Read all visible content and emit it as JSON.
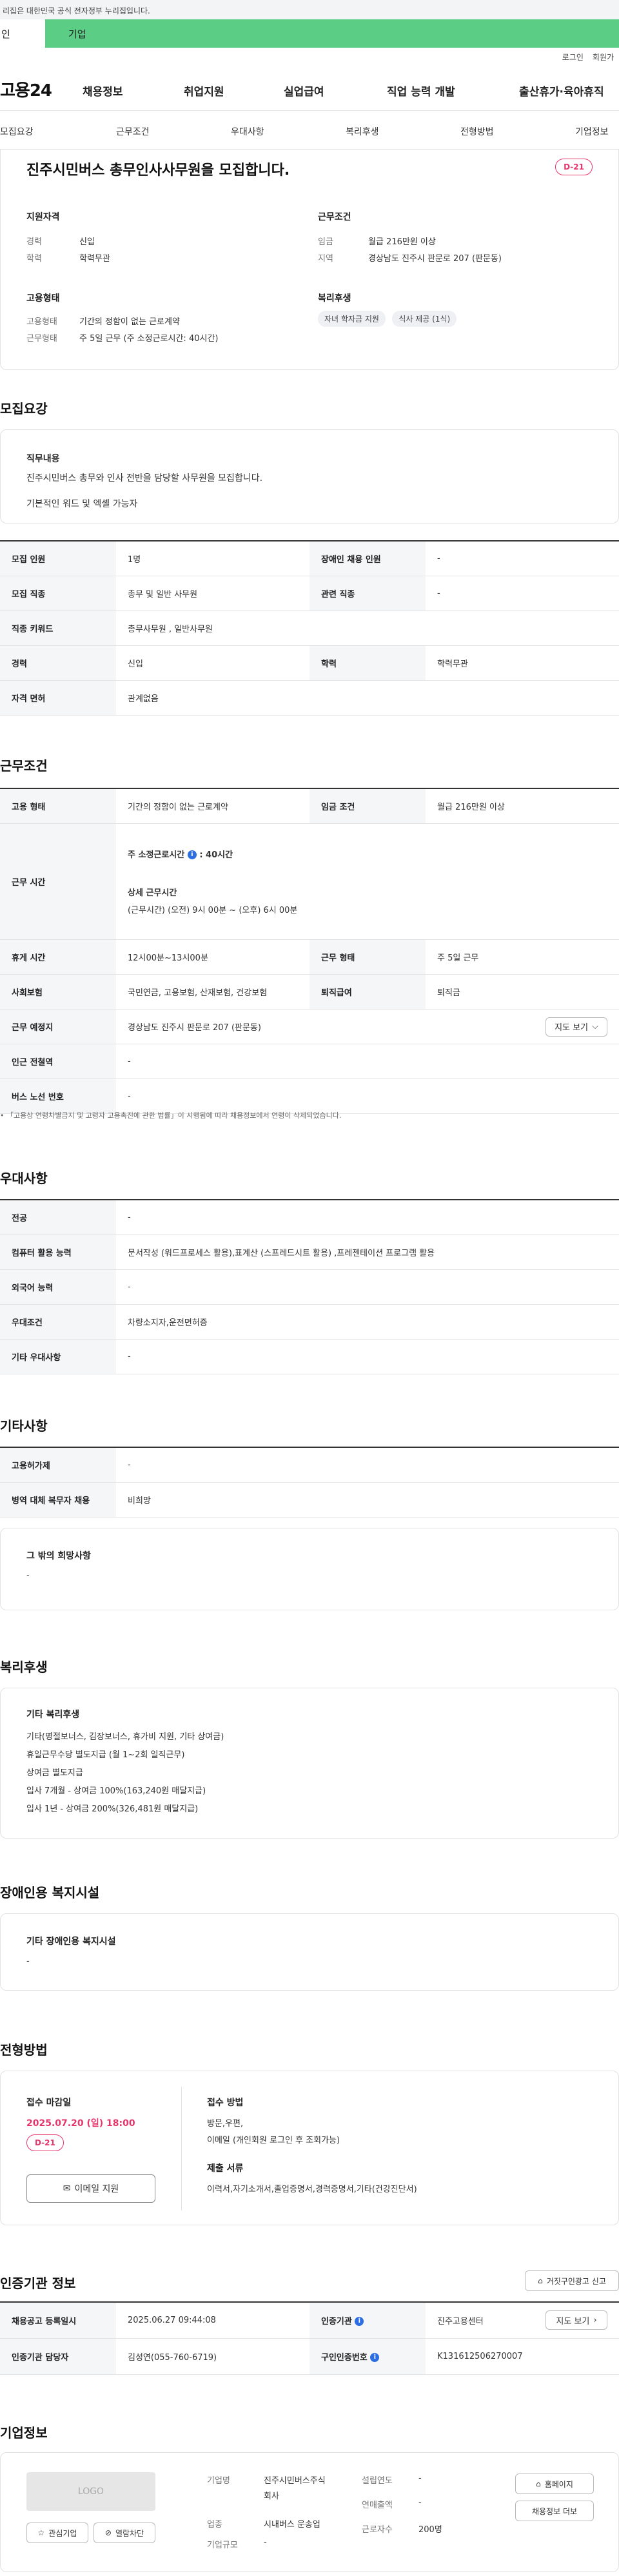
{
  "gov_bar": "이 누리집은 대한민국 공식 전자정부 누리집입니다.",
  "gov_bar_visible": "리집은 대한민국 공식 전자정부 누리집입니다.",
  "tabs": {
    "personal": "인",
    "company": "기업"
  },
  "util": {
    "login": "로그인",
    "join": "회원가"
  },
  "logo": "고용24",
  "gnb": [
    "채용정보",
    "취업지원",
    "실업급여",
    "직업 능력 개발",
    "출산휴가·육아휴직"
  ],
  "subtabs": [
    "모집요강",
    "근무조건",
    "우대사항",
    "복리후생",
    "전형방법",
    "기업정보"
  ],
  "summary": {
    "title": "진주시민버스 총무인사사무원을 모집합니다.",
    "dday": "D-21",
    "qual": {
      "heading": "지원자격",
      "rows": [
        {
          "k": "경력",
          "v": "신입"
        },
        {
          "k": "학력",
          "v": "학력무관"
        }
      ]
    },
    "cond": {
      "heading": "근무조건",
      "rows": [
        {
          "k": "임금",
          "v": "월급 216만원 이상"
        },
        {
          "k": "지역",
          "v": "경상남도 진주시 판문로 207 (판문동)"
        }
      ]
    },
    "emp": {
      "heading": "고용형태",
      "rows": [
        {
          "k": "고용형태",
          "v": "기간의 정함이 없는 근로계약"
        },
        {
          "k": "근무형태",
          "v": "주 5일 근무 (주 소정근로시간: 40시간)"
        }
      ]
    },
    "welfare": {
      "heading": "복리후생",
      "chips": [
        "자녀 학자금 지원",
        "식사 제공 (1식)"
      ]
    }
  },
  "recruit": {
    "title": "모집요강",
    "job_heading": "직무내용",
    "job_lines": [
      "진주시민버스 총무와 인사 전반을 담당할 사무원을 모집합니다.",
      "기본적인 워드 및 엑셀 가능자"
    ],
    "table": [
      {
        "k1": "모집 인원",
        "v1": "1명",
        "k2": "장애인 채용 인원",
        "v2": "-"
      },
      {
        "k1": "모집 직종",
        "v1": "총무 및 일반 사무원",
        "k2": "관련 직종",
        "v2": "-"
      },
      {
        "k1": "직종 키워드",
        "v1": "총무사무원 , 일반사무원"
      },
      {
        "k1": "경력",
        "v1": "신입",
        "k2": "학력",
        "v2": "학력무관"
      },
      {
        "k1": "자격 면허",
        "v1": "관계없음"
      }
    ]
  },
  "work": {
    "title": "근무조건",
    "emp_type_k": "고용 형태",
    "emp_type_v": "기간의 정함이 없는 근로계약",
    "wage_k": "임금 조건",
    "wage_v": "월급 216만원 이상",
    "hours_k": "근무 시간",
    "hours_week_label": "주 소정근로시간",
    "hours_week_value": ": 40시간",
    "hours_detail_label": "상세 근무시간",
    "hours_detail_value": "(근무시간) (오전) 9시 00분 ~ (오후) 6시 00분",
    "rest_k": "휴게 시간",
    "rest_v": "12시00분~13시00분",
    "shift_k": "근무 형태",
    "shift_v": "주 5일 근무",
    "ins_k": "사회보험",
    "ins_v": "국민연금, 고용보험, 산재보험, 건강보험",
    "sev_k": "퇴직급여",
    "sev_v": "퇴직금",
    "place_k": "근무 예정지",
    "place_v": "경상남도 진주시 판문로 207 (판문동)",
    "map_btn": "지도 보기",
    "subway_k": "인근 전철역",
    "subway_v": "-",
    "bus_k": "버스 노선 번호",
    "bus_v": "-",
    "note": "「고용상 연령차별금지 및 고령자 고용촉진에 관한 법률」이 시행됨에 따라 채용정보에서 연령이 삭제되었습니다."
  },
  "pref": {
    "title": "우대사항",
    "rows": [
      {
        "k": "전공",
        "v": "-"
      },
      {
        "k": "컴퓨터 활용 능력",
        "v": "문서작성 (워드프로세스 활용),표계산 (스프레드시트 활용) ,프레젠테이션 프로그램 활용"
      },
      {
        "k": "외국어 능력",
        "v": "-"
      },
      {
        "k": "우대조건",
        "v": "차량소지자,운전면허증"
      },
      {
        "k": "기타 우대사항",
        "v": "-"
      }
    ]
  },
  "etc": {
    "title": "기타사항",
    "rows": [
      {
        "k": "고용허가제",
        "v": "-"
      },
      {
        "k": "병역 대체 복무자 채용",
        "v": "비희망"
      }
    ],
    "other_heading": "그 밖의 희망사항",
    "other_value": "-"
  },
  "benefit": {
    "title": "복리후생",
    "heading": "기타 복리후생",
    "lines": [
      "기타(명절보너스, 김장보너스, 휴가비 지원, 기타 상여금)",
      "휴일근무수당 별도지급 (월 1~2회 일직근무)",
      "상여금 별도지급",
      "입사 7개월 - 상여금 100%(163,240원 매달지급)",
      "입사 1년 - 상여금 200%(326,481원 매달지급)"
    ]
  },
  "disability": {
    "title": "장애인용 복지시설",
    "heading": "기타 장애인용 복지시설",
    "value": "-"
  },
  "screening": {
    "title": "전형방법",
    "deadline_heading": "접수 마감일",
    "deadline": "2025.07.20 (일) 18:00",
    "dday": "D-21",
    "email_btn": "이메일 지원",
    "method_heading": "접수 방법",
    "method_lines": [
      "방문,우편,",
      "이메일 (개인회원 로그인 후 조회가능)"
    ],
    "docs_heading": "제출 서류",
    "docs_value": "이력서,자기소개서,졸업증명서,경력증명서,기타(건강진단서)"
  },
  "auth": {
    "title": "인증기관 정보",
    "report_btn": "거짓구인광고 신고",
    "reg_date_k": "채용공고 등록일시",
    "reg_date_v": "2025.06.27 09:44:08",
    "org_k": "인증기관",
    "org_v": "진주고용센터",
    "map_btn": "지도 보기",
    "manager_k": "인증기관 담당자",
    "manager_v": "김성연(055-760-6719)",
    "reg_no_k": "구인인증번호",
    "reg_no_v": "K131612506270007"
  },
  "company": {
    "title": "기업정보",
    "logo_text": "LOGO",
    "fav_btn": "관심기업",
    "block_btn": "열람차단",
    "name_k": "기업명",
    "name_v": [
      "진주시민버스주식",
      "회사"
    ],
    "industry_k": "업종",
    "industry_v": "시내버스 운송업",
    "size_k": "기업규모",
    "size_v": "-",
    "founded_k": "설립연도",
    "founded_v": "-",
    "sales_k": "연매출액",
    "sales_v": "-",
    "employees_k": "근로자수",
    "employees_v": "200명",
    "home_btn": "홈페이지",
    "jobs_btn": "채용정보 더보"
  }
}
